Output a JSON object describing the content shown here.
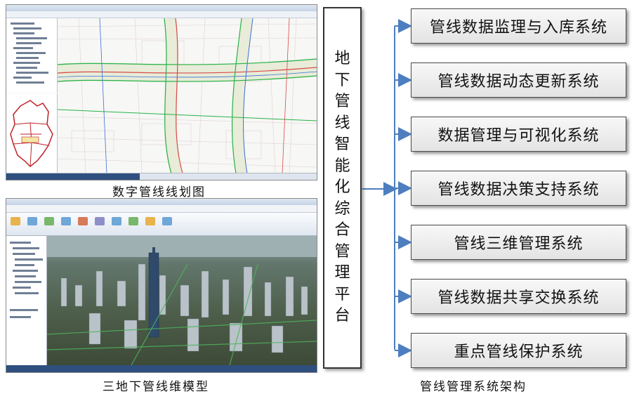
{
  "left_panel": {
    "map_caption": "数字管线线划图",
    "scene_caption": "三地下管线维模型"
  },
  "architecture": {
    "caption": "管线管理系统架构",
    "platform": "地下管线智能化综合管理平台",
    "systems": [
      "管线数据监理与入库系统",
      "管线数据动态更新系统",
      "数据管理与可视化系统",
      "管线数据决策支持系统",
      "管线三维管理系统",
      "管线数据共享交换系统",
      "重点管线保护系统"
    ]
  },
  "colors": {
    "connector": "#4d7ebf",
    "box_border": "#4a4a4a",
    "map_road": "#e8ecd8",
    "map_pipe_green": "#27b24a",
    "map_pipe_red": "#d94b4b",
    "map_pipe_blue": "#3b6fd8",
    "district_outline": "#c0222a"
  }
}
